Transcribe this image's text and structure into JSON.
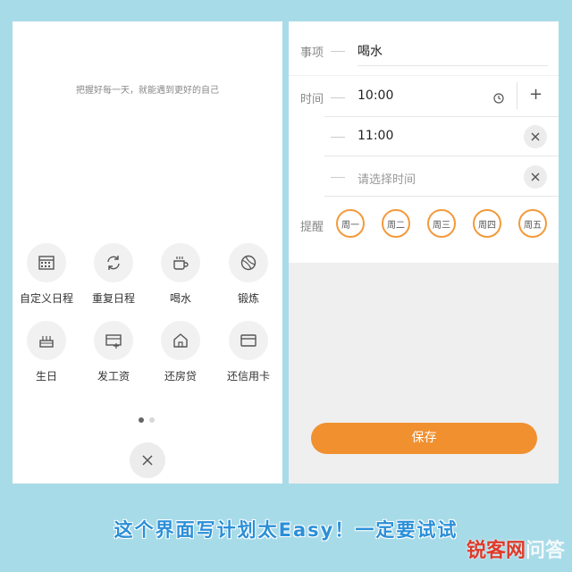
{
  "left_panel": {
    "tagline": "把握好每一天，就能遇到更好的自己",
    "items": [
      {
        "label": "自定义日程",
        "icon": "calendar-icon"
      },
      {
        "label": "重复日程",
        "icon": "refresh-icon"
      },
      {
        "label": "喝水",
        "icon": "cup-icon"
      },
      {
        "label": "锻炼",
        "icon": "ball-icon"
      },
      {
        "label": "生日",
        "icon": "cake-icon"
      },
      {
        "label": "发工资",
        "icon": "salary-card-icon"
      },
      {
        "label": "还房贷",
        "icon": "house-icon"
      },
      {
        "label": "还信用卡",
        "icon": "credit-card-icon"
      }
    ],
    "page_indicator": {
      "current": 1,
      "total": 2
    }
  },
  "right_panel": {
    "item_label": "事项",
    "item_value": "喝水",
    "time_label": "时间",
    "times": [
      "10:00",
      "11:00"
    ],
    "time_placeholder": "请选择时间",
    "add_symbol": "+",
    "remind_label": "提醒",
    "days": [
      "周一",
      "周二",
      "周三",
      "周四",
      "周五"
    ],
    "save_label": "保存"
  },
  "caption": "这个界面写计划太Easy！一定要试试",
  "watermark": {
    "part1": "锐客",
    "part2": "网",
    "part3": "问答"
  },
  "colors": {
    "accent": "#f0902f",
    "background": "#a8dbe8"
  }
}
